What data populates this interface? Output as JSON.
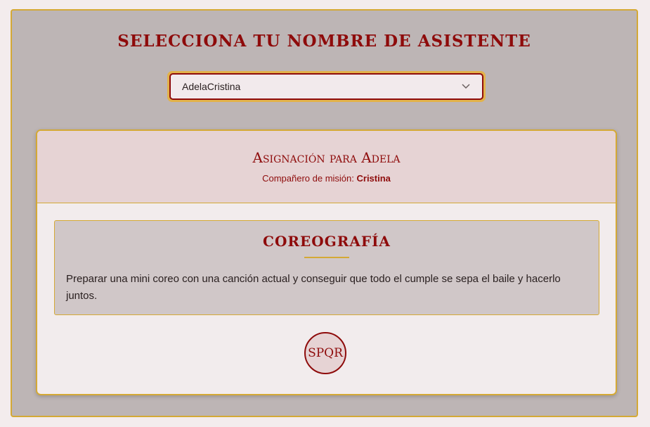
{
  "header": {
    "title": "SELECCIONA TU NOMBRE DE ASISTENTE"
  },
  "selector": {
    "selected": "AdelaCristina",
    "icon": "chevron-down-icon"
  },
  "assignment": {
    "title": "Asignación para Adela",
    "partner_label": "Compañero de misión:",
    "partner_name": "Cristina"
  },
  "task": {
    "title": "COREOGRAFÍA",
    "description": "Preparar una mini coreo con una canción actual y conseguir que todo el cumple se sepa el baile y hacerlo juntos."
  },
  "seal": {
    "text": "SPQR"
  },
  "colors": {
    "accent": "#8e0b0b",
    "gold": "#d4a935",
    "background": "#bdb5b5"
  }
}
